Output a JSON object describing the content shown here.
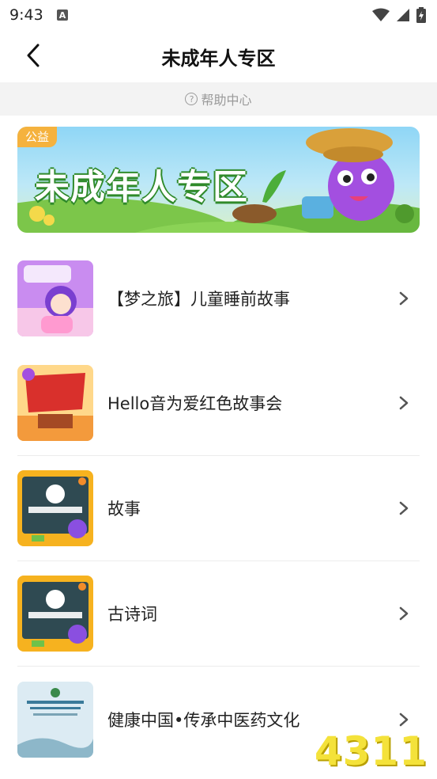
{
  "status_bar": {
    "time": "9:43",
    "icons": [
      "notification-a-icon",
      "wifi-icon",
      "signal-icon",
      "battery-icon"
    ]
  },
  "nav": {
    "back_icon": "chevron-left-icon",
    "title": "未成年人专区"
  },
  "help": {
    "icon": "question-circle-icon",
    "label": "帮助中心"
  },
  "banner": {
    "tag": "公益",
    "title": "未成年人专区"
  },
  "items": [
    {
      "title": "【梦之旅】儿童睡前故事",
      "thumb_icon": "cartoon-girl-thumbnail"
    },
    {
      "title": "Hello音为爱红色故事会",
      "thumb_icon": "red-story-thumbnail"
    },
    {
      "title": "故事",
      "thumb_icon": "volunteer-board-thumbnail"
    },
    {
      "title": "古诗词",
      "thumb_icon": "volunteer-board-thumbnail"
    },
    {
      "title": "健康中国•传承中医药文化",
      "thumb_icon": "poster-thumbnail"
    }
  ],
  "watermark": "4311",
  "colors": {
    "accent_orange": "#f5b23e",
    "banner_green": "#2f8a2a",
    "divider": "#ececec"
  }
}
